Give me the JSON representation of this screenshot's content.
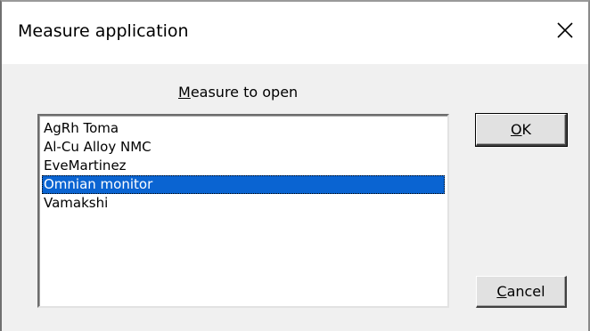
{
  "window": {
    "title": "Measure application"
  },
  "list": {
    "caption_mnemonic": "M",
    "caption_rest": "easure to open",
    "items": [
      "AgRh Toma",
      "Al-Cu Alloy NMC",
      "EveMartinez",
      "Omnian monitor",
      "Vamakshi"
    ],
    "selected_item": "Omnian monitor"
  },
  "buttons": {
    "ok_mnemonic": "O",
    "ok_rest": "K",
    "cancel_mnemonic": "C",
    "cancel_rest": "ancel"
  },
  "colors": {
    "selection": "#0a64d2",
    "dialog_face": "#f0f0f0",
    "titlebar": "#ffffff"
  },
  "icons": {
    "close": "close-icon"
  }
}
